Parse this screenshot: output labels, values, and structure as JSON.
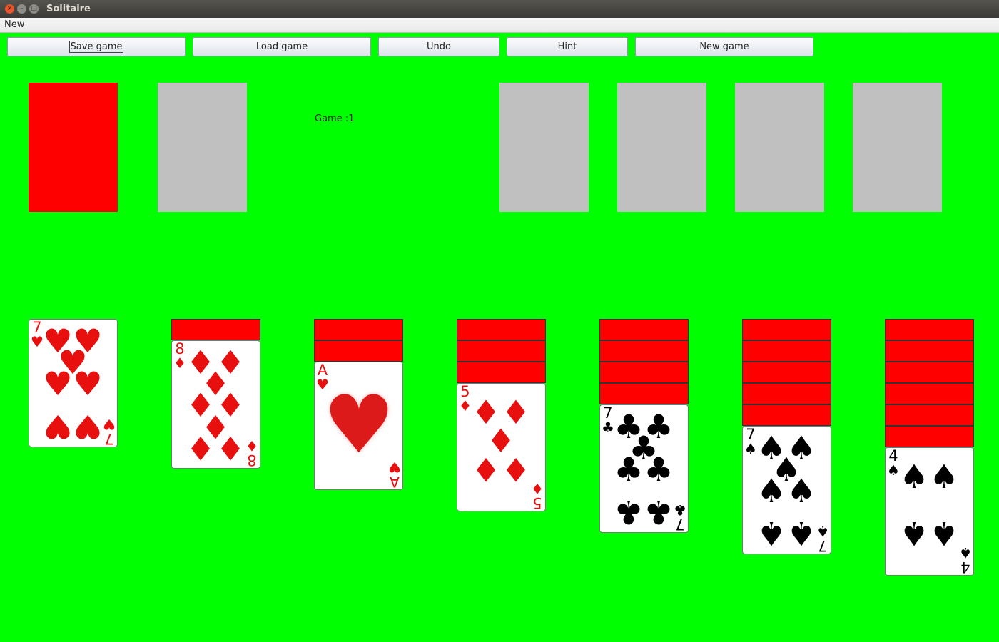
{
  "window": {
    "title": "Solitaire",
    "controls": [
      "×",
      "–",
      "□"
    ]
  },
  "menubar": {
    "new_label": "New"
  },
  "toolbar": {
    "save_label": "Save game",
    "load_label": "Load game",
    "undo_label": "Undo",
    "hint_label": "Hint",
    "new_game_label": "New game"
  },
  "status": {
    "game_label": "Game :1"
  },
  "colors": {
    "table": "#00ff00",
    "card_back": "#ff0000",
    "empty_slot": "#c0c0c0",
    "red_suit": "#e8100f",
    "black_suit": "#000000"
  },
  "tableau": [
    {
      "hidden": 0,
      "rank": "7",
      "suit": "♥",
      "color": "red"
    },
    {
      "hidden": 1,
      "rank": "8",
      "suit": "♦",
      "color": "red"
    },
    {
      "hidden": 2,
      "rank": "A",
      "suit": "♥",
      "color": "red"
    },
    {
      "hidden": 3,
      "rank": "5",
      "suit": "♦",
      "color": "red"
    },
    {
      "hidden": 4,
      "rank": "7",
      "suit": "♣",
      "color": "black"
    },
    {
      "hidden": 5,
      "rank": "7",
      "suit": "♠",
      "color": "black"
    },
    {
      "hidden": 6,
      "rank": "4",
      "suit": "♠",
      "color": "black"
    }
  ]
}
